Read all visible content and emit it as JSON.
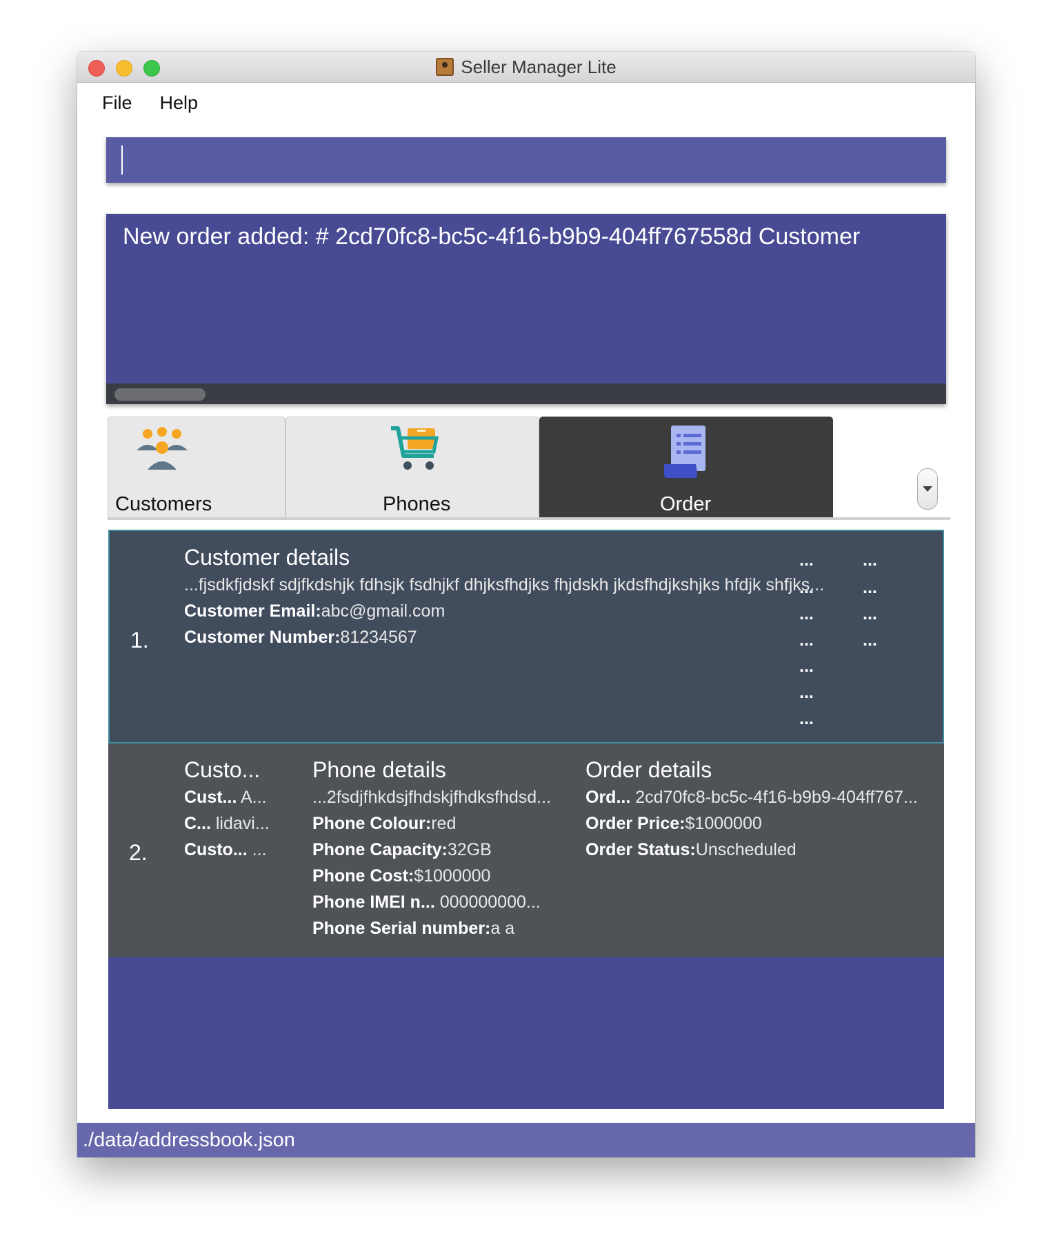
{
  "window": {
    "title": "Seller Manager Lite"
  },
  "menu": {
    "file": "File",
    "help": "Help"
  },
  "command": {
    "value": ""
  },
  "result": {
    "text": "New order added:  # 2cd70fc8-bc5c-4f16-b9b9-404ff767558d Customer"
  },
  "tabs": [
    {
      "label": "Customers",
      "icon": "customers-icon",
      "active": false
    },
    {
      "label": "Phones",
      "icon": "shopping-cart-icon",
      "active": false
    },
    {
      "label": "Order",
      "icon": "order-receipt-icon",
      "active": true
    }
  ],
  "orders": [
    {
      "index": "1.",
      "customer_heading": "Customer details",
      "customer_lines": [
        {
          "label": "",
          "value": "...fjsdkfjdskf sdjfkdshjk fdhsjk fsdhjkf dhjksfhdjks fhjdskh jkdsfhdjkshjks hfdjk shfjks..."
        },
        {
          "label": "Customer Email:",
          "value": "abc@gmail.com"
        },
        {
          "label": "Customer Number:",
          "value": "81234567"
        }
      ],
      "col2_heading": "...",
      "col2_lines": [
        "...",
        "...",
        "...",
        "...",
        "...",
        "..."
      ],
      "col3_heading": "...",
      "col3_lines": [
        "...",
        "...",
        "..."
      ]
    },
    {
      "index": "2.",
      "customer_heading": "Custo...",
      "customer_lines": [
        {
          "label": "Cust...",
          "value": "A..."
        },
        {
          "label": "C...",
          "value": "lidavi..."
        },
        {
          "label": "Custo...",
          "value": "..."
        }
      ],
      "phone_heading": "Phone details",
      "phone_lines": [
        {
          "label": "",
          "value": "...2fsdjfhkdsjfhdskjfhdksfhdsd..."
        },
        {
          "label": "Phone Colour:",
          "value": "red"
        },
        {
          "label": "Phone Capacity:",
          "value": "32GB"
        },
        {
          "label": "Phone Cost:",
          "value": "$1000000"
        },
        {
          "label": "Phone IMEI n...",
          "value": "000000000..."
        },
        {
          "label": "Phone Serial number:",
          "value": "a a"
        }
      ],
      "order_heading": "Order details",
      "order_lines": [
        {
          "label": "Ord...",
          "value": "2cd70fc8-bc5c-4f16-b9b9-404ff767..."
        },
        {
          "label": "Order Price:",
          "value": "$1000000"
        },
        {
          "label": "Order Status:",
          "value": "Unscheduled"
        }
      ]
    }
  ],
  "status": {
    "path": "./data/addressbook.json"
  },
  "colors": {
    "command_bg": "#5a5ca3",
    "result_bg": "#484a94",
    "row_selected": "#414c5d",
    "row_normal": "#4f5358",
    "status_bg": "#6768ab",
    "active_tab": "#3c3c3c"
  }
}
